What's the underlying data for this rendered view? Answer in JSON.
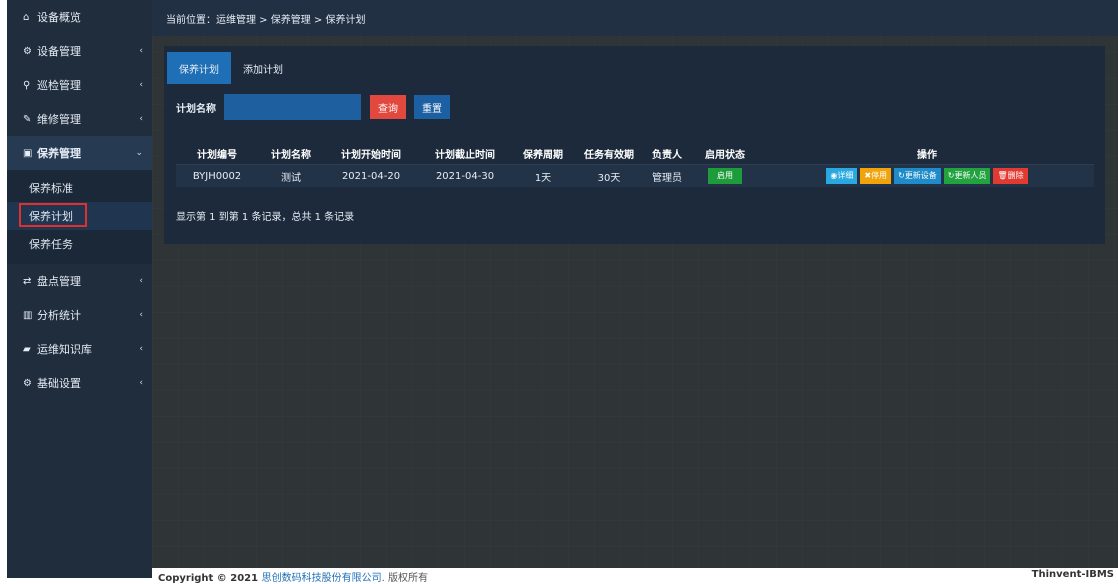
{
  "sidebar": {
    "items": [
      {
        "icon": "home-icon",
        "glyph": "⌂",
        "label": "设备概览",
        "chevron": ""
      },
      {
        "icon": "cogs-icon",
        "glyph": "⚙",
        "label": "设备管理",
        "chevron": "‹"
      },
      {
        "icon": "search-icon",
        "glyph": "⚲",
        "label": "巡检管理",
        "chevron": "‹"
      },
      {
        "icon": "wrench-icon",
        "glyph": "✎",
        "label": "维修管理",
        "chevron": "‹"
      },
      {
        "icon": "briefcase-icon",
        "glyph": "▣",
        "label": "保养管理",
        "chevron": "⌄"
      },
      {
        "icon": "exchange-icon",
        "glyph": "⇄",
        "label": "盘点管理",
        "chevron": "‹"
      },
      {
        "icon": "bar-chart-icon",
        "glyph": "▥",
        "label": "分析统计",
        "chevron": "‹"
      },
      {
        "icon": "book-icon",
        "glyph": "▰",
        "label": "运维知识库",
        "chevron": "‹"
      },
      {
        "icon": "cogs-icon",
        "glyph": "⚙",
        "label": "基础设置",
        "chevron": "‹"
      }
    ],
    "sub_items": [
      {
        "label": "保养标准"
      },
      {
        "label": "保养计划"
      },
      {
        "label": "保养任务"
      }
    ]
  },
  "breadcrumb": "当前位置：运维管理 > 保养管理 > 保养计划",
  "tabs": [
    {
      "label": "保养计划"
    },
    {
      "label": "添加计划"
    }
  ],
  "search": {
    "label": "计划名称",
    "value": "",
    "placeholder": "",
    "query_label": "查询",
    "reset_label": "重置"
  },
  "table": {
    "headers": [
      "计划编号",
      "计划名称",
      "计划开始时间",
      "计划截止时间",
      "保养周期",
      "任务有效期",
      "负责人",
      "启用状态",
      "操作"
    ],
    "rows": [
      {
        "code": "BYJH0002",
        "name": "测试",
        "start": "2021-04-20",
        "end": "2021-04-30",
        "cycle": "1天",
        "validity": "30天",
        "owner": "管理员",
        "status": "启用"
      }
    ],
    "actions": {
      "detail": "◉详细",
      "disable": "✖停用",
      "update_device": "↻更新设备",
      "update_user": "↻更新人员",
      "delete": "🗑删除"
    }
  },
  "summary": "显示第 1 到第 1 条记录，总共 1 条记录",
  "footer": {
    "prefix": "Copyright © 2021 ",
    "company": "思创数码科技股份有限公司",
    "suffix": ". 版权所有",
    "brand": "Thinvent-IBMS"
  }
}
